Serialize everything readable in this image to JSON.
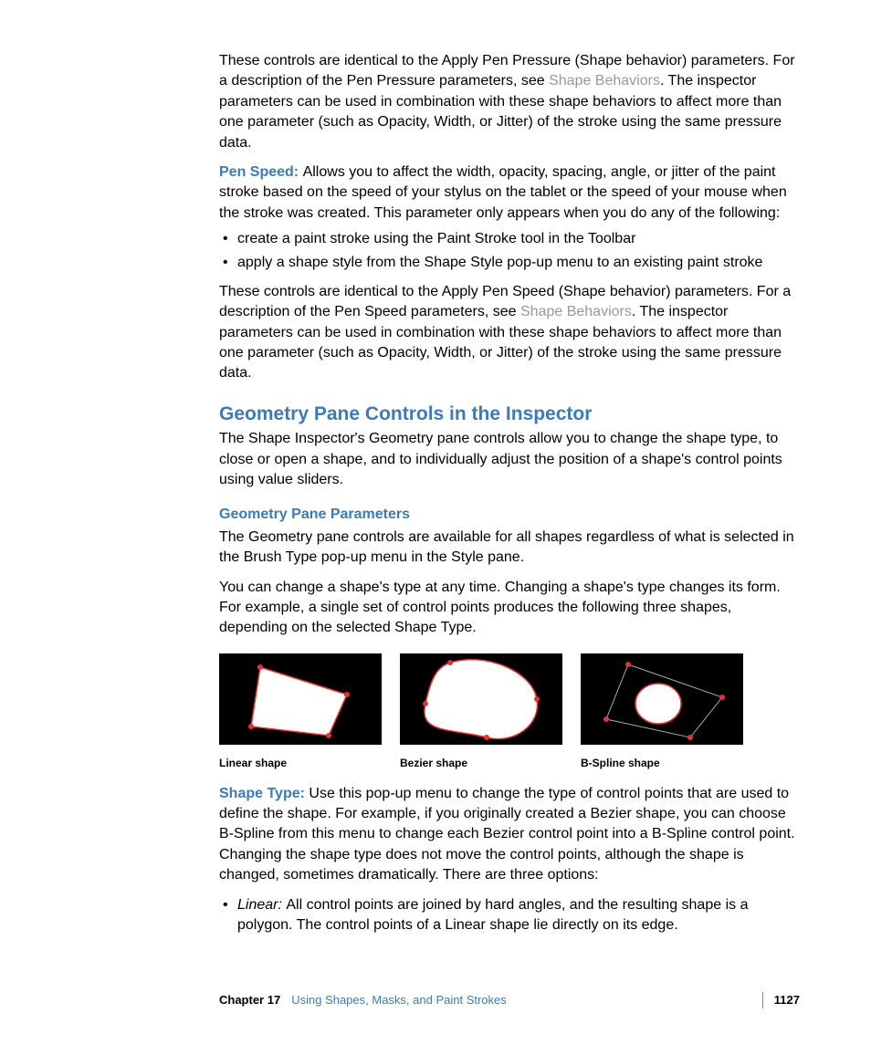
{
  "para1": {
    "t1": "These controls are identical to the Apply Pen Pressure (Shape behavior) parameters. For a description of the Pen Pressure parameters, see ",
    "link": "Shape Behaviors",
    "t2": ". The inspector parameters can be used in combination with these shape behaviors to affect more than one parameter (such as Opacity, Width, or Jitter) of the stroke using the same pressure data."
  },
  "penspeed": {
    "label": "Pen Speed:  ",
    "desc": "Allows you to affect the width, opacity, spacing, angle, or jitter of the paint stroke based on the speed of your stylus on the tablet or the speed of your mouse when the stroke was created. This parameter only appears when you do any of the following:"
  },
  "bullets1": [
    "create a paint stroke using the Paint Stroke tool in the Toolbar",
    "apply a shape style from the Shape Style pop-up menu to an existing paint stroke"
  ],
  "para2": {
    "t1": "These controls are identical to the Apply Pen Speed (Shape behavior) parameters. For a description of the Pen Speed parameters, see ",
    "link": "Shape Behaviors",
    "t2": ". The inspector parameters can be used in combination with these shape behaviors to affect more than one parameter (such as Opacity, Width, or Jitter) of the stroke using the same pressure data."
  },
  "section_heading": "Geometry Pane Controls in the Inspector",
  "section_intro": "The Shape Inspector's Geometry pane controls allow you to change the shape type, to close or open a shape, and to individually adjust the position of a shape's control points using value sliders.",
  "subsection_heading": "Geometry Pane Parameters",
  "sub_p1": "The Geometry pane controls are available for all shapes regardless of what is selected in the Brush Type pop-up menu in the Style pane.",
  "sub_p2": "You can change a shape's type at any time. Changing a shape's type changes its form. For example, a single set of control points produces the following three shapes, depending on the selected Shape Type.",
  "figures": [
    "Linear shape",
    "Bezier shape",
    "B-Spline shape"
  ],
  "shapetype": {
    "label": "Shape Type:  ",
    "desc": "Use this pop-up menu to change the type of control points that are used to define the shape. For example, if you originally created a Bezier shape, you can choose B-Spline from this menu to change each Bezier control point into a B-Spline control point. Changing the shape type does not move the control points, although the shape is changed, sometimes dramatically. There are three options:"
  },
  "linear": {
    "label": "Linear:  ",
    "desc": "All control points are joined by hard angles, and the resulting shape is a polygon. The control points of a Linear shape lie directly on its edge."
  },
  "footer": {
    "chapter_num": "Chapter 17",
    "chapter_title": "Using Shapes, Masks, and Paint Strokes",
    "page": "1127"
  }
}
